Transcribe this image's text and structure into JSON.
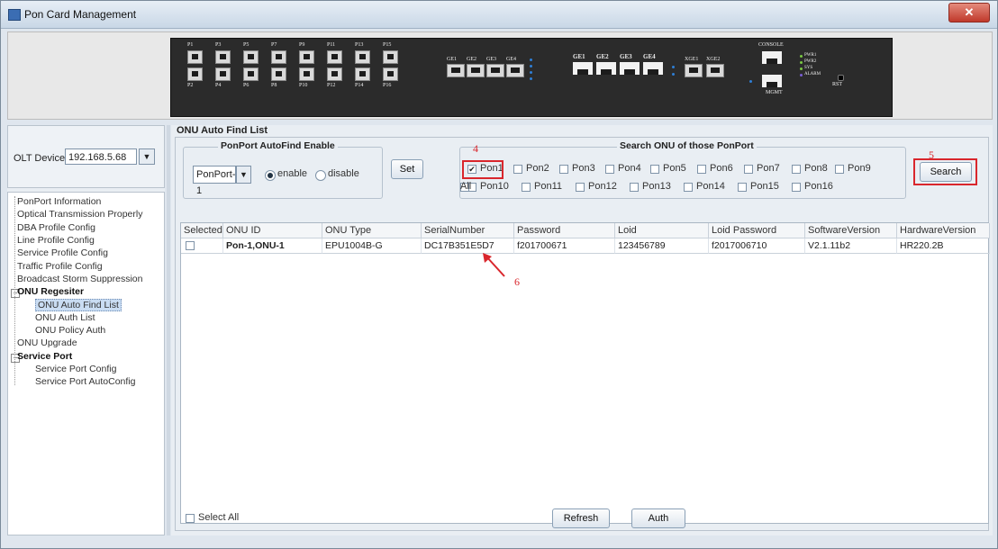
{
  "window": {
    "title": "Pon Card Management",
    "close_glyph": "✕"
  },
  "device_panel": {
    "pon_ports_top": [
      "P1",
      "P3",
      "P5",
      "P7",
      "P9",
      "P11",
      "P13",
      "P15"
    ],
    "pon_ports_bottom": [
      "P2",
      "P4",
      "P6",
      "P8",
      "P10",
      "P12",
      "P14",
      "P16"
    ],
    "combo_ports": [
      "GE1",
      "GE2",
      "GE3",
      "GE4"
    ],
    "ge_ports": [
      "GE1",
      "GE2",
      "GE3",
      "GE4"
    ],
    "xge_ports": [
      "XGE1",
      "XGE2"
    ],
    "console_label": "CONSOLE",
    "mgmt_label": "MGMT",
    "status_leds": [
      "PWR1",
      "PWR2",
      "SYS",
      "ALARM"
    ],
    "reset_label": "RST"
  },
  "left": {
    "olt_label": "OLT Device",
    "olt_value": "192.168.5.68",
    "tree": [
      {
        "label": "PonPort Information",
        "level": 0,
        "group": false
      },
      {
        "label": "Optical Transmission Properly",
        "level": 0,
        "group": false
      },
      {
        "label": "DBA Profile Config",
        "level": 0,
        "group": false
      },
      {
        "label": "Line Profile Config",
        "level": 0,
        "group": false
      },
      {
        "label": "Service Profile Config",
        "level": 0,
        "group": false
      },
      {
        "label": "Traffic Profile Config",
        "level": 0,
        "group": false
      },
      {
        "label": "Broadcast Storm Suppression",
        "level": 0,
        "group": false
      },
      {
        "label": "ONU Regesiter",
        "level": 0,
        "group": true
      },
      {
        "label": "ONU Auto Find List",
        "level": 1,
        "group": false,
        "selected": true
      },
      {
        "label": "ONU Auth List",
        "level": 1,
        "group": false
      },
      {
        "label": "ONU Policy Auth",
        "level": 1,
        "group": false
      },
      {
        "label": "ONU Upgrade",
        "level": 0,
        "group": false
      },
      {
        "label": "Service Port",
        "level": 0,
        "group": true
      },
      {
        "label": "Service Port Config",
        "level": 1,
        "group": false
      },
      {
        "label": "Service Port AutoConfig",
        "level": 1,
        "group": false
      }
    ]
  },
  "main": {
    "title": "ONU Auto Find List",
    "autofind": {
      "group_title": "PonPort AutoFind Enable",
      "port_value": "PonPort-1",
      "enable_label": "enable",
      "disable_label": "disable",
      "set_label": "Set"
    },
    "search_group_title": "Search ONU of those PonPort",
    "pon_checkboxes": [
      {
        "label": "Pon1",
        "checked": true
      },
      {
        "label": "Pon2",
        "checked": false
      },
      {
        "label": "Pon3",
        "checked": false
      },
      {
        "label": "Pon4",
        "checked": false
      },
      {
        "label": "Pon5",
        "checked": false
      },
      {
        "label": "Pon6",
        "checked": false
      },
      {
        "label": "Pon7",
        "checked": false
      },
      {
        "label": "Pon8",
        "checked": false
      },
      {
        "label": "Pon9",
        "checked": false
      },
      {
        "label": "Pon10",
        "checked": false
      },
      {
        "label": "Pon11",
        "checked": false
      },
      {
        "label": "Pon12",
        "checked": false
      },
      {
        "label": "Pon13",
        "checked": false
      },
      {
        "label": "Pon14",
        "checked": false
      },
      {
        "label": "Pon15",
        "checked": false
      },
      {
        "label": "Pon16",
        "checked": false
      },
      {
        "label": "All",
        "checked": false
      }
    ],
    "search_label": "Search",
    "annotations": {
      "a4": "4",
      "a5": "5",
      "a6": "6"
    },
    "table": {
      "columns": [
        "Selected",
        "ONU ID",
        "ONU Type",
        "SerialNumber",
        "Password",
        "Loid",
        "Loid Password",
        "SoftwareVersion",
        "HardwareVersion"
      ],
      "rows": [
        [
          "",
          "Pon-1,ONU-1",
          "EPU1004B-G",
          "DC17B351E5D7",
          "f201700671",
          "123456789",
          "f2017006710",
          "V2.1.11b2",
          "HR220.2B"
        ]
      ]
    },
    "footer": {
      "select_all_label": "Select All",
      "refresh_label": "Refresh",
      "auth_label": "Auth"
    }
  }
}
